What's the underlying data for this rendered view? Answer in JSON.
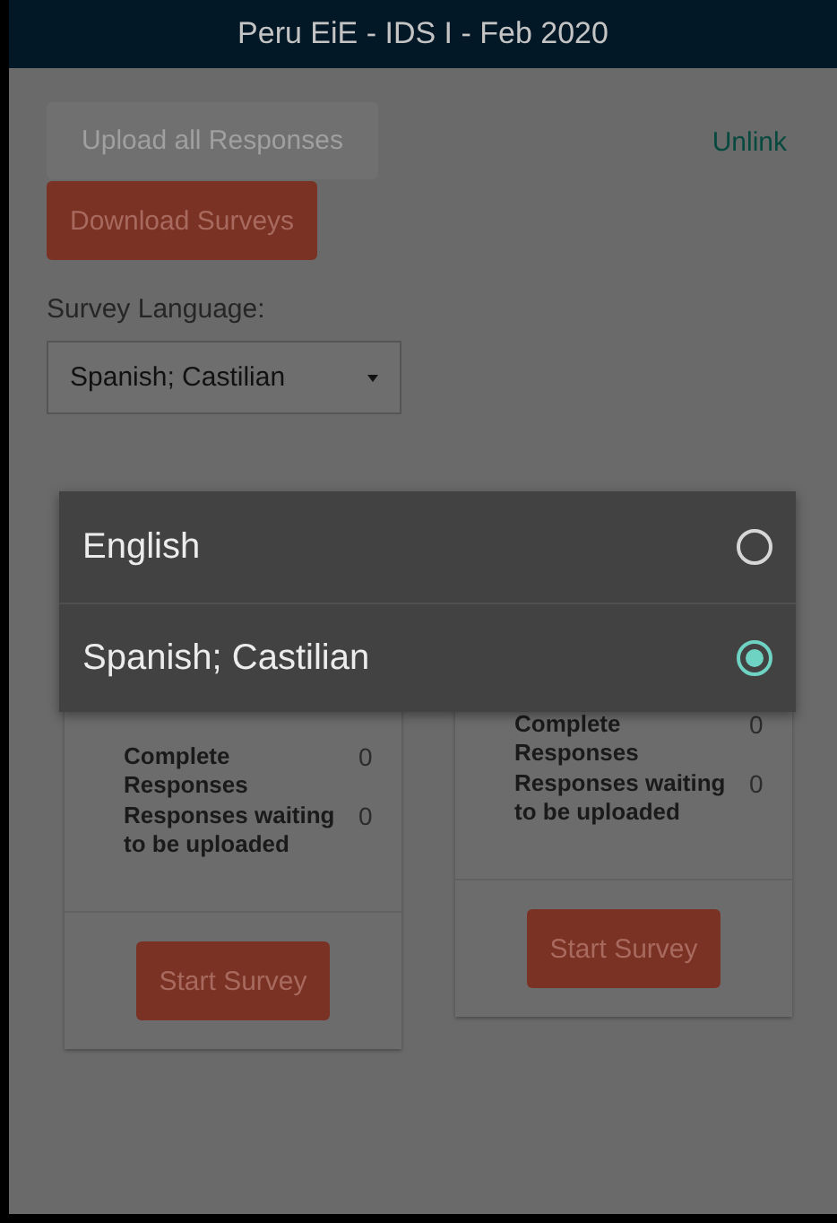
{
  "app_bar": {
    "title": "Peru EiE - IDS I - Feb 2020"
  },
  "actions": {
    "upload_button": {
      "label": "Upload all Responses",
      "disabled": true
    },
    "unlink_link": "Unlink",
    "download_button": {
      "label": "Download Surveys",
      "disabled": false
    }
  },
  "language": {
    "label": "Survey Language:",
    "value": "Spanish; Castilian"
  },
  "cards": [
    {
      "stats": [
        {
          "label": "Complete Responses",
          "value": "0"
        },
        {
          "label": "Responses waiting to be uploaded",
          "value": "0"
        }
      ],
      "button": "Start Survey"
    },
    {
      "stats": [
        {
          "label": "Complete Responses",
          "value": "0"
        },
        {
          "label": "Responses waiting to be uploaded",
          "value": "0"
        }
      ],
      "button": "Start Survey"
    }
  ],
  "dialog": {
    "options": [
      {
        "label": "English",
        "selected": false
      },
      {
        "label": "Spanish; Castilian",
        "selected": true
      }
    ]
  }
}
